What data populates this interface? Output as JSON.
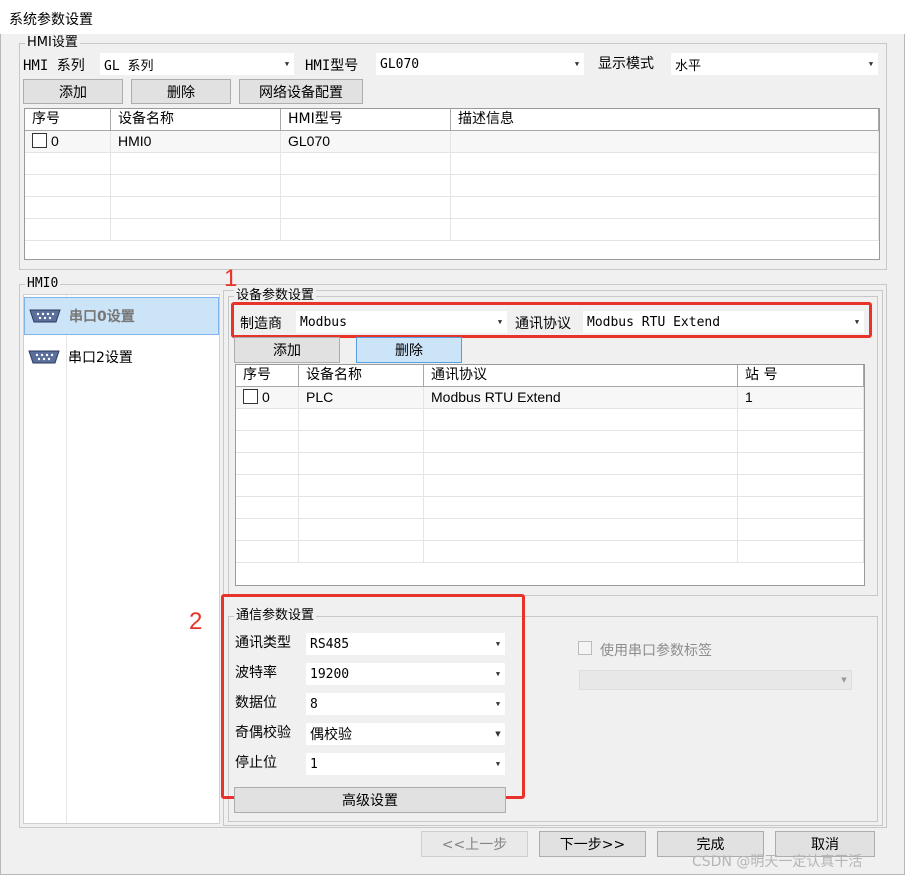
{
  "window": {
    "title": "系统参数设置"
  },
  "hmi_settings": {
    "legend": "HMI设置",
    "series_label": "HMI 系列",
    "series_value": "GL 系列",
    "model_label": "HMI型号",
    "model_value": "GL070",
    "display_label": "显示模式",
    "display_value": "水平",
    "add_label": "添加",
    "delete_label": "删除",
    "network_label": "网络设备配置",
    "columns": [
      "序号",
      "设备名称",
      "HMI型号",
      "描述信息"
    ],
    "rows": [
      {
        "index": "0",
        "name": "HMI0",
        "model": "GL070",
        "desc": ""
      }
    ]
  },
  "hmi0_panel": {
    "legend": "HMI0",
    "ports": [
      {
        "label": "串口0设置"
      },
      {
        "label": "串口2设置"
      }
    ]
  },
  "device_params": {
    "legend": "设备参数设置",
    "maker_label": "制造商",
    "maker_value": "Modbus",
    "protocol_label": "通讯协议",
    "protocol_value": "Modbus RTU Extend",
    "add_label": "添加",
    "delete_label": "删除",
    "columns": [
      "序号",
      "设备名称",
      "通讯协议",
      "站 号"
    ],
    "rows": [
      {
        "index": "0",
        "name": "PLC",
        "protocol": "Modbus RTU Extend",
        "station": "1"
      }
    ]
  },
  "comm_params": {
    "legend": "通信参数设置",
    "type_label": "通讯类型",
    "type_value": "RS485",
    "baud_label": "波特率",
    "baud_value": "19200",
    "databits_label": "数据位",
    "databits_value": "8",
    "parity_label": "奇偶校验",
    "parity_value": "偶校验",
    "stopbits_label": "停止位",
    "stopbits_value": "1",
    "advanced_label": "高级设置",
    "use_port_tag_label": "使用串口参数标签"
  },
  "annotations": {
    "one": "1",
    "two": "2"
  },
  "footer": {
    "prev_label": "<<上一步",
    "next_label": "下一步>>",
    "finish_label": "完成",
    "cancel_label": "取消"
  },
  "watermark": "CSDN @明天一定认真干活",
  "colors": {
    "highlight_red": "#e8332a",
    "selection_blue": "#cce4f7"
  },
  "icons": {
    "port": "serial-port-icon",
    "dropdown": "dropdown-arrow-icon"
  }
}
